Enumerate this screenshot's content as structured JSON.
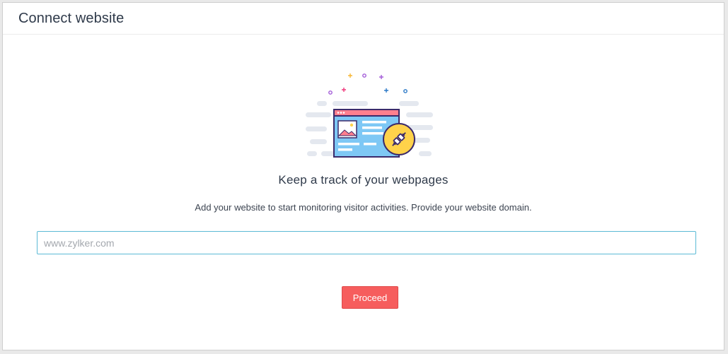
{
  "header": {
    "title": "Connect website"
  },
  "main": {
    "headline": "Keep a track of your webpages",
    "description": "Add your website to start monitoring visitor activities. Provide your website domain.",
    "domain_input": {
      "value": "",
      "placeholder": "www.zylker.com"
    },
    "proceed_label": "Proceed"
  },
  "illustration": {
    "icon": "connect-plug-icon",
    "colors": {
      "browser_header": "#ff7f8e",
      "browser_body": "#7ec8f5",
      "outline": "#3b2a6b",
      "plug_badge": "#ffd24a",
      "speed_lines": "#e4e8ef"
    }
  },
  "theme": {
    "accent": "#f65d5d",
    "input_focus_border": "#5bbad5"
  }
}
